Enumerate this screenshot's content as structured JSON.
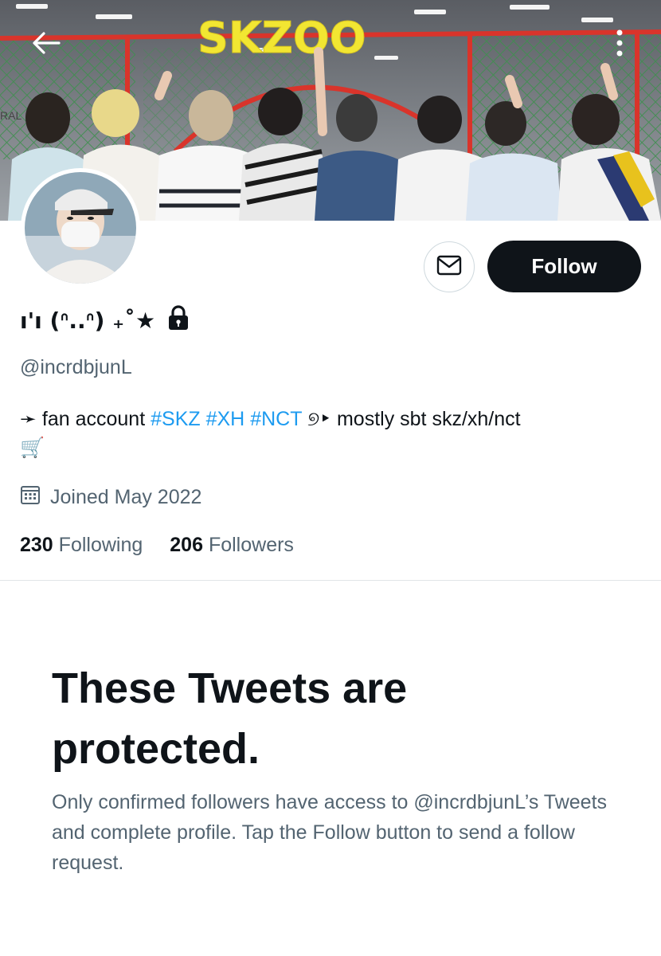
{
  "banner": {
    "sign_text": "SKZOO",
    "sign_color": "#f2e632",
    "frame_color": "#d9342b",
    "net_color": "#3f8f4f",
    "side_text": "RAL"
  },
  "header": {
    "back_icon": "arrow-left-icon",
    "more_icon": "more-vertical-icon"
  },
  "profile": {
    "display_name": "ı'ı (ᐢ..ᐢ) ₊˚★",
    "protected_icon": "lock-icon",
    "handle": "@incrdbjunL",
    "bio_prefix": "➛ fan account ",
    "hashtags": [
      "#SKZ",
      "#XH",
      "#NCT"
    ],
    "bio_suffix": " ୭‣ mostly sbt skz/xh/nct",
    "bio_emoji": "🛒",
    "joined": "Joined May 2022",
    "following_count": "230",
    "following_label": "Following",
    "followers_count": "206",
    "followers_label": "Followers"
  },
  "actions": {
    "message_icon": "envelope-icon",
    "follow_label": "Follow"
  },
  "protected": {
    "title": "These Tweets are protected.",
    "body": "Only confirmed followers have access to @incrdbjunL’s Tweets and complete profile. Tap the Follow button to send a follow request."
  },
  "colors": {
    "text": "#0f1419",
    "secondary": "#536471",
    "link": "#1d9bf0",
    "button_bg": "#0f1419"
  }
}
